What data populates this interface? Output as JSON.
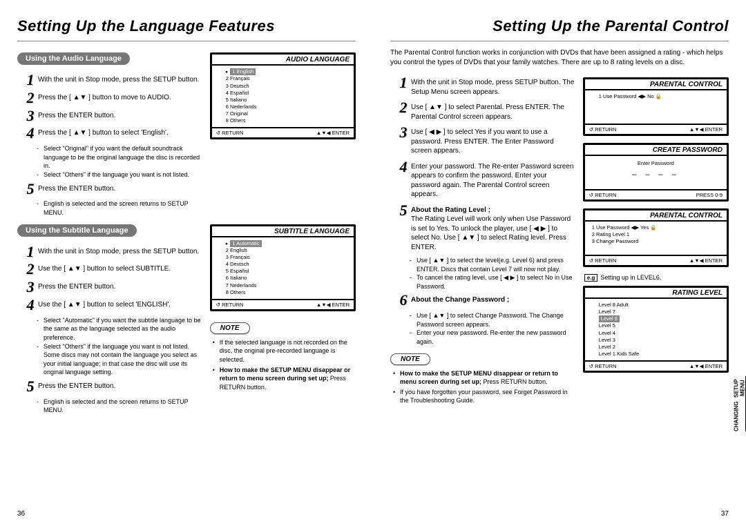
{
  "left": {
    "title": "Setting Up the Language Features",
    "sections": [
      {
        "pill": "Using the Audio Language",
        "panel": {
          "title": "AUDIO LANGUAGE",
          "items": [
            "1 English",
            "2 Français",
            "3 Deutsch",
            "4 Español",
            "5 Italiano",
            "6 Nederlands",
            "7 Original",
            "8 Others"
          ],
          "highlight": 0,
          "footer_left": "↺ RETURN",
          "footer_right": "▲▼◀ ENTER"
        },
        "steps": [
          "With the unit in Stop mode, press the SETUP button.",
          "Press the [ ▲▼ ] button to move to AUDIO.",
          "Press the ENTER button.",
          "Press the [ ▲▼ ] button to select 'English'."
        ],
        "sub_after_4": [
          "Select \"Original\" if you want the default soundtrack language to be the original language the disc is recorded in.",
          "Select \"Others\" if the language you want is not listed."
        ],
        "step5": "Press the ENTER button.",
        "sub_after_5": [
          "English is selected and the screen returns to SETUP MENU."
        ]
      },
      {
        "pill": "Using the Subtitle Language",
        "panel": {
          "title": "SUBTITLE LANGUAGE",
          "items": [
            "1 Automatic",
            "2 English",
            "3 Français",
            "4 Deutsch",
            "5 Español",
            "6 Italiano",
            "7 Nederlands",
            "8 Others"
          ],
          "highlight": 0,
          "footer_left": "↺ RETURN",
          "footer_right": "▲▼◀ ENTER"
        },
        "steps": [
          "With the unit in Stop mode, press the SETUP button.",
          "Use the [ ▲▼ ] button to select SUBTITLE.",
          "Press the ENTER button.",
          "Use the [ ▲▼ ] button to select 'ENGLISH'."
        ],
        "sub_after_4": [
          "Select \"Automatic\" if you want the subtitle language to be the same as the language selected as the audio preference.",
          "Select \"Others\" if the language you want is not listed. Some discs may not contain the language you select as your initial language; in that case the disc will use its original language setting."
        ],
        "step5": "Press the ENTER button.",
        "sub_after_5": [
          "English is selected and the screen returns to SETUP MENU."
        ],
        "note": {
          "label": "NOTE",
          "bullets": [
            "If the selected language is not recorded on the disc, the original pre-recorded language is selected."
          ],
          "bold_bullet": "How to make the SETUP MENU disappear or return to menu screen during set up;",
          "tail": "Press RETURN button."
        }
      }
    ],
    "page_num": "36"
  },
  "right": {
    "title": "Setting Up the Parental Control",
    "intro": "The Parental Control function works in conjunction with DVDs that have been assigned a rating - which helps you control the types of DVDs that your family watches. There are up to 8 rating levels on a disc.",
    "steps": [
      "With the unit in Stop mode, press SETUP button. The Setup Menu screen appears.",
      "Use [ ▲▼ ] to select Parental. Press ENTER. The Parental Control screen appears.",
      "Use [ ◀ ▶ ] to select Yes if you want to use a password. Press ENTER. The Enter Password screen appears.",
      "Enter your password. The Re-enter Password screen appears to confirm the password. Enter your password again. The Parental Control screen appears."
    ],
    "step5_heading": "About the Rating Level ;",
    "step5_body": "The Rating Level will work only when Use Password is set to Yes. To unlock the player, use [ ◀ ▶ ] to select No. Use [ ▲▼ ] to select Rating level. Press ENTER.",
    "step5_sub": [
      "Use [ ▲▼ ] to select the level(e.g. Level 6) and press ENTER. Discs that contain Level 7 will now not play.",
      "To cancel the rating level, use [ ◀ ▶ ] to select No in Use Password."
    ],
    "step6_heading": "About the Change Password ;",
    "step6_sub": [
      "Use [ ▲▼ ] to select Change Password. The Change Password screen appears.",
      "Enter your new password. Re-enter the new password again."
    ],
    "panels": {
      "p1": {
        "title": "PARENTAL CONTROL",
        "row": "1   Use Password  ◀▶  No  🔒",
        "footer_left": "↺ RETURN",
        "footer_right": "▲▼◀ ENTER"
      },
      "p2": {
        "title": "CREATE PASSWORD",
        "label": "Enter Password",
        "dashes": "– – – –",
        "footer_left": "↺ RETURN",
        "footer_right": "PRESS 0-9"
      },
      "p3": {
        "title": "PARENTAL CONTROL",
        "rows": [
          "1   Use Password   ◀▶  Yes 🔒",
          "2   Rating Level             1",
          "3   Change Password"
        ],
        "footer_left": "↺ RETURN",
        "footer_right": "▲▼◀ ENTER"
      },
      "eg": "Setting up in LEVEL6.",
      "p4": {
        "title": "RATING  LEVEL",
        "rows": [
          "Level 8 Adult",
          "Level 7",
          "Level 6",
          "Level 5",
          "Level 4",
          "Level 3",
          "Level 2",
          "Level 1 Kids Safe"
        ],
        "highlight": 2,
        "footer_left": "↺ RETURN",
        "footer_right": "▲▼◀ ENTER"
      }
    },
    "note": {
      "label": "NOTE",
      "bold_bullet": "How to make the SETUP MENU disappear or return to menu screen during set up;",
      "tail": "Press RETURN button.",
      "bullet2": "If you have forgotten your password, see Forget Password in the Troubleshooting Guide."
    },
    "page_num": "37",
    "side_tab": {
      "line1": "CHANGING",
      "line2": "SETUP MENU"
    }
  }
}
